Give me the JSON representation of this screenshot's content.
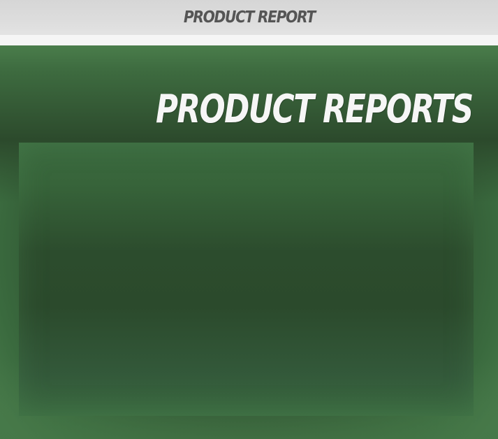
{
  "header": {
    "title": "PRODUCT REPORT"
  },
  "main": {
    "heading": "PRODUCT REPORTS"
  },
  "colors": {
    "header_bg": "#dcdcdc",
    "header_text": "#555555",
    "main_bg": "#2c4d2e",
    "heading_text": "#f6f6f6",
    "panel_bg": "#2f5531"
  }
}
